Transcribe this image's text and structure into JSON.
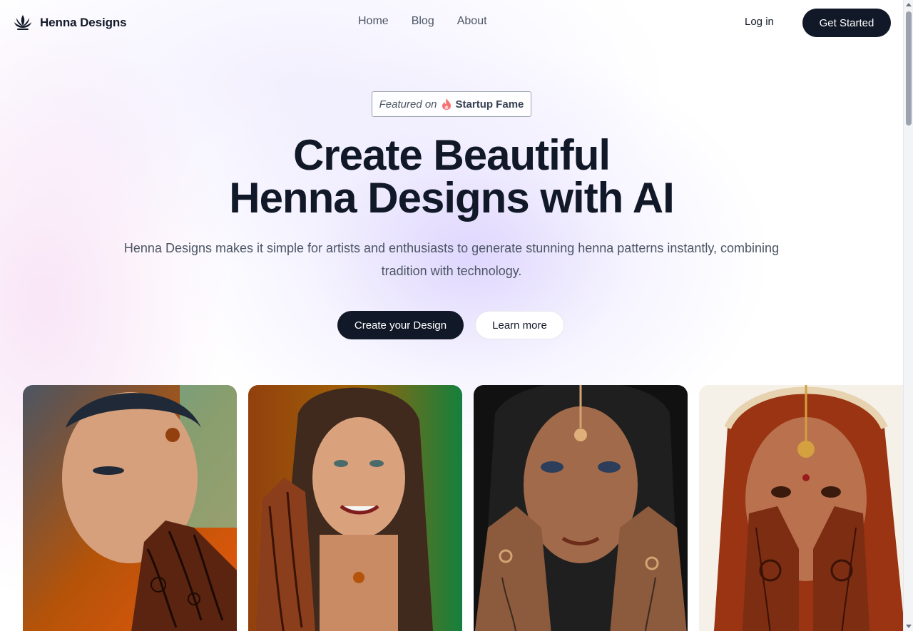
{
  "header": {
    "brand_name": "Henna Designs",
    "logo_icon": "lotus-icon",
    "nav": [
      {
        "label": "Home"
      },
      {
        "label": "Blog"
      },
      {
        "label": "About"
      }
    ],
    "login_label": "Log in",
    "get_started_label": "Get Started"
  },
  "hero": {
    "badge": {
      "prefix": "Featured on",
      "name": "Startup Fame",
      "icon": "flame-icon",
      "icon_color": "#f87171"
    },
    "headline_line1": "Create Beautiful",
    "headline_line2": "Henna Designs with AI",
    "subtext": "Henna Designs makes it simple for artists and enthusiasts to generate stunning henna patterns instantly, combining tradition with technology.",
    "primary_cta": "Create your Design",
    "secondary_cta": "Learn more"
  },
  "gallery": {
    "cards": [
      {
        "subject": "woman-with-henna-hand-profile"
      },
      {
        "subject": "smiling-woman-with-henna-hand"
      },
      {
        "subject": "woman-with-jewelry-and-henna-hands"
      },
      {
        "subject": "bride-covering-face-with-henna-hands"
      }
    ]
  },
  "colors": {
    "primary": "#111827",
    "text_muted": "#4b5563",
    "accent_glow": "#c4b5fd",
    "henna": "#7c2d12"
  }
}
